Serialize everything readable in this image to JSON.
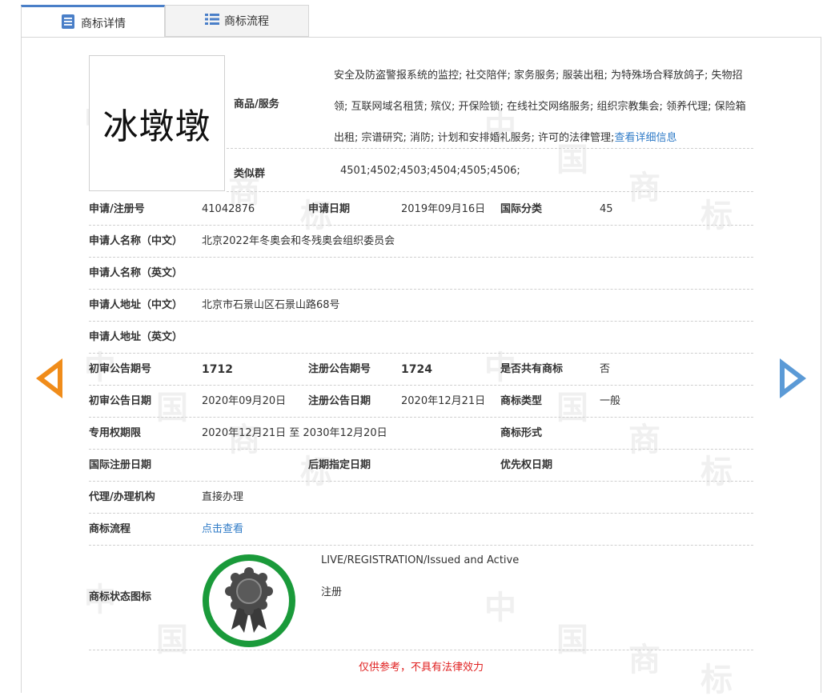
{
  "tabs": [
    {
      "label": "商标详情",
      "icon": "list-document-icon",
      "active": true
    },
    {
      "label": "商标流程",
      "icon": "list-grid-icon",
      "active": false
    }
  ],
  "watermark": {
    "chars": [
      "中",
      "国",
      "商",
      "标"
    ]
  },
  "logo": {
    "text": "冰墩墩"
  },
  "goods": {
    "label": "商品/服务",
    "text": "安全及防盗警报系统的监控; 社交陪伴; 家务服务; 服装出租; 为特殊场合释放鸽子; 失物招领; 互联网域名租赁; 殡仪; 开保险锁; 在线社交网络服务; 组织宗教集会; 领养代理; 保险箱出租; 宗谱研究; 消防; 计划和安排婚礼服务; 许可的法律管理;",
    "link": "查看详细信息"
  },
  "similar": {
    "label": "类似群",
    "value": "4501;4502;4503;4504;4505;4506;"
  },
  "rows": {
    "reg_no_label": "申请/注册号",
    "reg_no": "41042876",
    "apply_date_label": "申请日期",
    "apply_date": "2019年09月16日",
    "intl_class_label": "国际分类",
    "intl_class": "45",
    "applicant_cn_label": "申请人名称（中文）",
    "applicant_cn": "北京2022年冬奥会和冬残奥会组织委员会",
    "applicant_en_label": "申请人名称（英文）",
    "applicant_en": "",
    "address_cn_label": "申请人地址（中文）",
    "address_cn": "北京市石景山区石景山路68号",
    "address_en_label": "申请人地址（英文）",
    "address_en": "",
    "prelim_no_label": "初审公告期号",
    "prelim_no": "1712",
    "reg_pub_no_label": "注册公告期号",
    "reg_pub_no": "1724",
    "shared_label": "是否共有商标",
    "shared": "否",
    "prelim_date_label": "初审公告日期",
    "prelim_date": "2020年09月20日",
    "reg_pub_date_label": "注册公告日期",
    "reg_pub_date": "2020年12月21日",
    "tm_type_label": "商标类型",
    "tm_type": "一般",
    "exclusive_label": "专用权期限",
    "exclusive": "2020年12月21日 至 2030年12月20日",
    "tm_form_label": "商标形式",
    "tm_form": "",
    "intl_reg_date_label": "国际注册日期",
    "intl_reg_date": "",
    "later_date_label": "后期指定日期",
    "later_date": "",
    "priority_date_label": "优先权日期",
    "priority_date": "",
    "agent_label": "代理/办理机构",
    "agent": "直接办理",
    "process_label": "商标流程",
    "process_link": "点击查看",
    "status_label": "商标状态图标",
    "status_en": "LIVE/REGISTRATION/Issued and Active",
    "status_cn": "注册"
  },
  "disclaimer": "仅供参考，不具有法律效力",
  "colors": {
    "accent_blue": "#2f7bc7",
    "status_green": "#1a9a3a",
    "arrow_orange": "#f08c1a",
    "arrow_blue": "#5b9ad6",
    "disclaimer_red": "#e02020"
  }
}
